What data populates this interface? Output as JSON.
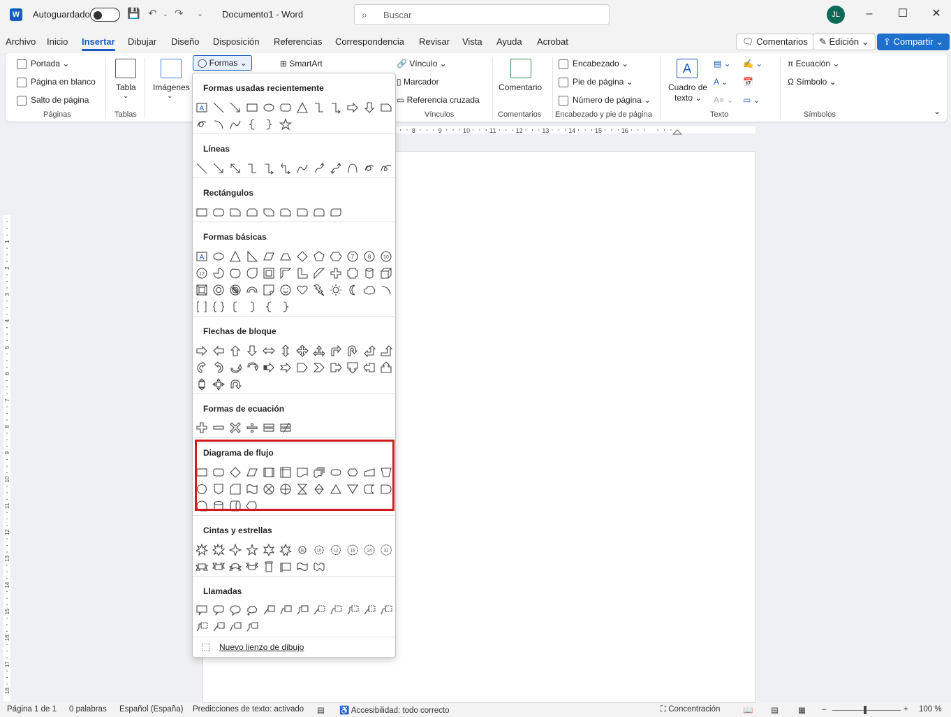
{
  "titlebar": {
    "app_badge": "W",
    "autosave_label": "Autoguardado",
    "doc_title": "Documento1  -  Word",
    "search_placeholder": "Buscar",
    "user_initials": "JL"
  },
  "tabs": [
    "Archivo",
    "Inicio",
    "Insertar",
    "Dibujar",
    "Diseño",
    "Disposición",
    "Referencias",
    "Correspondencia",
    "Revisar",
    "Vista",
    "Ayuda",
    "Acrobat"
  ],
  "top_buttons": {
    "comments": "Comentarios",
    "editing": "Edición",
    "share": "Compartir"
  },
  "ribbon": {
    "pages": {
      "portada": "Portada",
      "blank": "Página en blanco",
      "break": "Salto de página",
      "label": "Páginas"
    },
    "tables": {
      "tabla": "Tabla",
      "label": "Tablas"
    },
    "images": {
      "imagenes": "Imágenes"
    },
    "formas": "Formas",
    "smartart": "SmartArt",
    "links": {
      "vinculo": "Vínculo",
      "marcador": "Marcador",
      "ref": "Referencia cruzada",
      "label": "Vínculos"
    },
    "comments": {
      "comentario": "Comentario",
      "label": "Comentarios"
    },
    "header": {
      "encabezado": "Encabezado",
      "pie": "Pie de página",
      "numero": "Número de página",
      "label": "Encabezado y pie de página"
    },
    "text": {
      "cuadro1": "Cuadro de",
      "cuadro2": "texto",
      "label": "Texto"
    },
    "symbols": {
      "ecuacion": "Ecuación",
      "simbolo": "Símbolo",
      "label": "Símbolos"
    }
  },
  "shapes_menu": {
    "sections": [
      {
        "title": "Formas usadas recientemente",
        "shapes": [
          [
            "textbox",
            "line",
            "arrowline",
            "rect",
            "ellipse",
            "roundrect",
            "triangle",
            "elbow",
            "elbowarrow",
            "rightarrow",
            "downarrow",
            "snip"
          ],
          [
            "freeform",
            "arc",
            "curve",
            "lbrace",
            "rbrace",
            "star5"
          ]
        ]
      },
      {
        "title": "Líneas",
        "shapes": [
          [
            "line",
            "arrowline",
            "dblarrowline",
            "elbow",
            "elbowarrow",
            "elbowdbl",
            "curve",
            "curvearrow",
            "curvedbl",
            "curvecurve",
            "freeform",
            "scribble"
          ]
        ]
      },
      {
        "title": "Rectángulos",
        "shapes": [
          [
            "rect",
            "roundrect",
            "snip",
            "snip2",
            "snipdiag",
            "sniprounded",
            "rounded1",
            "rounded2",
            "roundeddiag"
          ]
        ]
      },
      {
        "title": "Formas básicas",
        "shapes": [
          [
            "textbox",
            "ellipse",
            "triangle",
            "rtriangle",
            "parallelogram",
            "trapezoid",
            "diamond",
            "pentagon",
            "hexagon",
            "n7",
            "n8",
            "n10"
          ],
          [
            "n12",
            "pie",
            "chord",
            "teardrop",
            "frame",
            "halfframe",
            "lshape",
            "diagstripe",
            "plus",
            "plaque",
            "can",
            "cube"
          ],
          [
            "bevel",
            "donut",
            "nosymbol",
            "blockarc",
            "foldedcorner",
            "smiley",
            "heart",
            "lightning",
            "sun",
            "moon",
            "cloud",
            "arc"
          ],
          [
            "dblbracket",
            "dblbrace",
            "lbracket",
            "rbracket",
            "lbrace",
            "rbrace"
          ]
        ]
      },
      {
        "title": "Flechas de bloque",
        "shapes": [
          [
            "rightarrow",
            "leftarrow",
            "uparrow",
            "downarrow",
            "lrarrow",
            "udarrow",
            "quadarrow",
            "lruarrow",
            "bentarrow",
            "uturn",
            "leftuparrow",
            "bentuparrow"
          ],
          [
            "curvedright",
            "curvedleft",
            "curvedup",
            "curveddown",
            "stripedright",
            "notchedright",
            "pentagonarrow",
            "chevron",
            "rightcallout",
            "downcallout",
            "leftcallout",
            "upcallout"
          ],
          [
            "udcallout",
            "quadcallout",
            "circulararrow"
          ]
        ]
      },
      {
        "title": "Formas de ecuación",
        "shapes": [
          [
            "plus",
            "minus",
            "multiply",
            "divide",
            "equal",
            "notequal"
          ]
        ]
      },
      {
        "title": "Diagrama de flujo",
        "shapes": [
          [
            "rect",
            "roundrect",
            "diamond",
            "parallelogram",
            "predefined",
            "internal",
            "document",
            "multidoc",
            "terminator",
            "preparation",
            "manualinput",
            "manualop"
          ],
          [
            "circle",
            "offpage",
            "card",
            "tape",
            "summing",
            "or",
            "collate",
            "sort",
            "extract",
            "merge",
            "storeddata",
            "delay"
          ],
          [
            "seqaccess",
            "magdisk",
            "directaccess",
            "display"
          ]
        ]
      },
      {
        "title": "Cintas y estrellas",
        "shapes": [
          [
            "explosion1",
            "explosion2",
            "star4",
            "star5",
            "star6",
            "star7",
            "star8",
            "star10",
            "star12",
            "star16",
            "star24",
            "star32"
          ],
          [
            "ribbonup",
            "ribbondown",
            "curvedribbonup",
            "curvedribbondown",
            "vscroll",
            "hscroll",
            "wave",
            "dblwave"
          ]
        ]
      },
      {
        "title": "Llamadas",
        "shapes": [
          [
            "rectcallout",
            "roundcallout",
            "ovalcallout",
            "cloudcallout",
            "linecallout1",
            "linecallout2",
            "linecallout3",
            "linecallout4",
            "linecallout5",
            "linecallout6",
            "linecallout7",
            "linecallout8"
          ],
          [
            "linecallout9",
            "linecallout10",
            "linecallout11",
            "linecallout12"
          ]
        ]
      }
    ],
    "new_canvas": "Nuevo lienzo de dibujo"
  },
  "status": {
    "page": "Página 1 de 1",
    "words": "0 palabras",
    "lang": "Español (España)",
    "predict": "Predicciones de texto: activado",
    "access": "Accesibilidad: todo correcto",
    "focus": "Concentración",
    "zoom": "100 %"
  },
  "colors": {
    "accent": "#185abd",
    "highlight": "#d11b1b",
    "share": "#1f6fcc"
  }
}
